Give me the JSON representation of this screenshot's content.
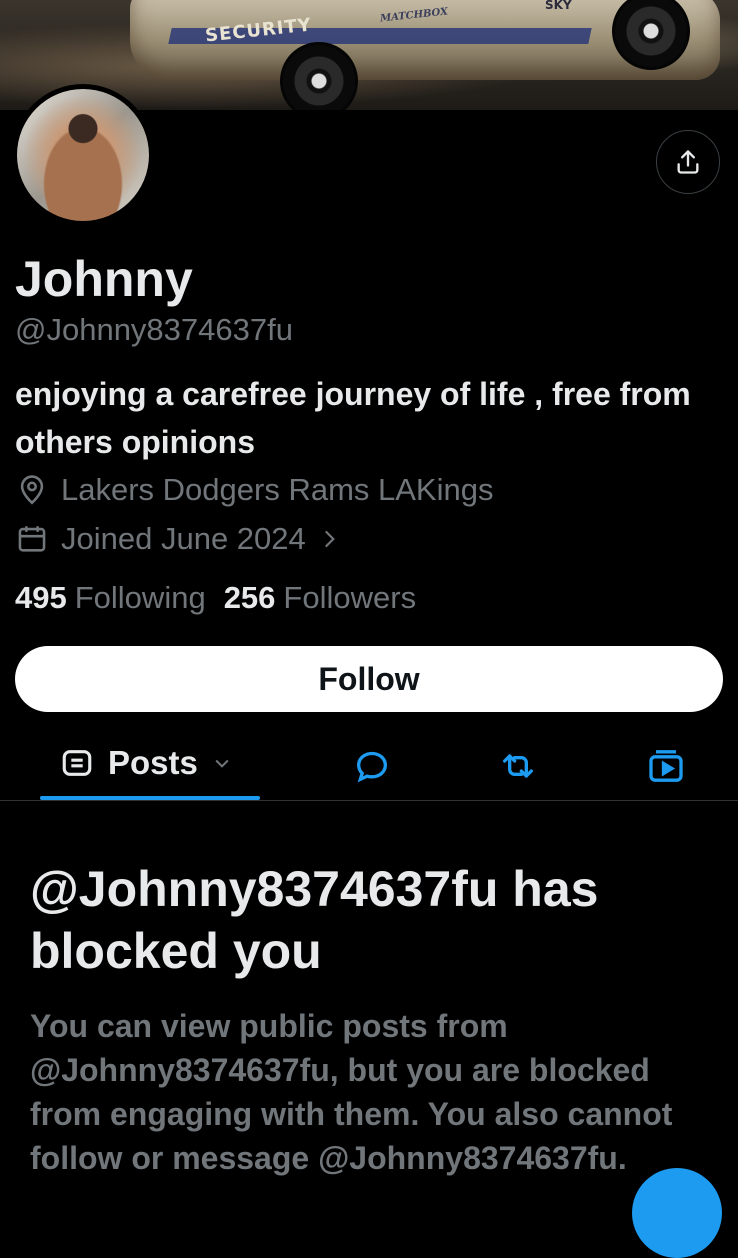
{
  "banner": {
    "car_text_security": "SECURITY",
    "car_text_brand": "MATCHBOX",
    "car_text_sky": "SKY"
  },
  "profile": {
    "name": "Johnny",
    "handle": "@Johnny8374637fu",
    "bio": "enjoying a carefree journey of life , free from others opinions",
    "location": "Lakers Dodgers Rams LAKings",
    "joined": "Joined June 2024",
    "following_count": "495",
    "following_label": "Following",
    "followers_count": "256",
    "followers_label": "Followers"
  },
  "actions": {
    "follow_label": "Follow"
  },
  "tabs": {
    "posts_label": "Posts"
  },
  "blocked": {
    "title": "@Johnny8374637fu has blocked you",
    "body": "You can view public posts from @Johnny8374637fu, but you are blocked from engaging with them. You also cannot follow or message @Johnny8374637fu."
  },
  "icons": {
    "share": "share-icon",
    "location": "location-pin-icon",
    "calendar": "calendar-icon",
    "replies": "reply-bubble-icon",
    "reposts": "repost-icon",
    "media": "media-icon"
  },
  "colors": {
    "background": "#000000",
    "primary_text": "#e7e9ea",
    "secondary_text": "#71767b",
    "accent": "#1d9bf0",
    "follow_button_bg": "#ffffff"
  }
}
